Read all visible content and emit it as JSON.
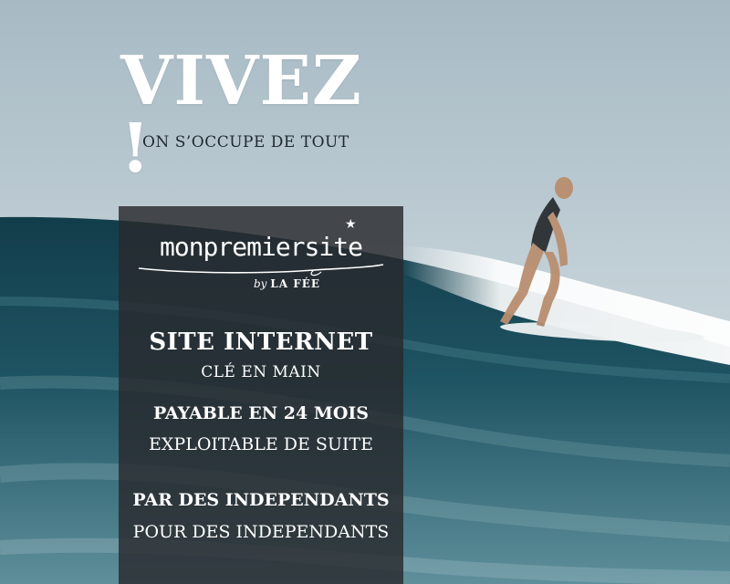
{
  "headline": "VIVEZ !",
  "tagline": "ON S’OCCUPE DE TOUT",
  "logo": {
    "name": "monpremiersite",
    "by": "by",
    "brand": "LA FÉE"
  },
  "panel": {
    "line1": "SITE INTERNET",
    "line2": "CLÉ EN MAIN",
    "line3": "PAYABLE EN 24 MOIS",
    "line4": "EXPLOITABLE DE SUITE",
    "line5": "PAR DES INDEPENDANTS",
    "line6": "POUR DES INDEPENDANTS"
  },
  "colors": {
    "sky_top": "#a9bcc6",
    "sky_bottom": "#dbe4e8",
    "sea_deep": "#0f3a48",
    "sea_mid": "#2c6574",
    "panel": "#2a2c2e"
  }
}
